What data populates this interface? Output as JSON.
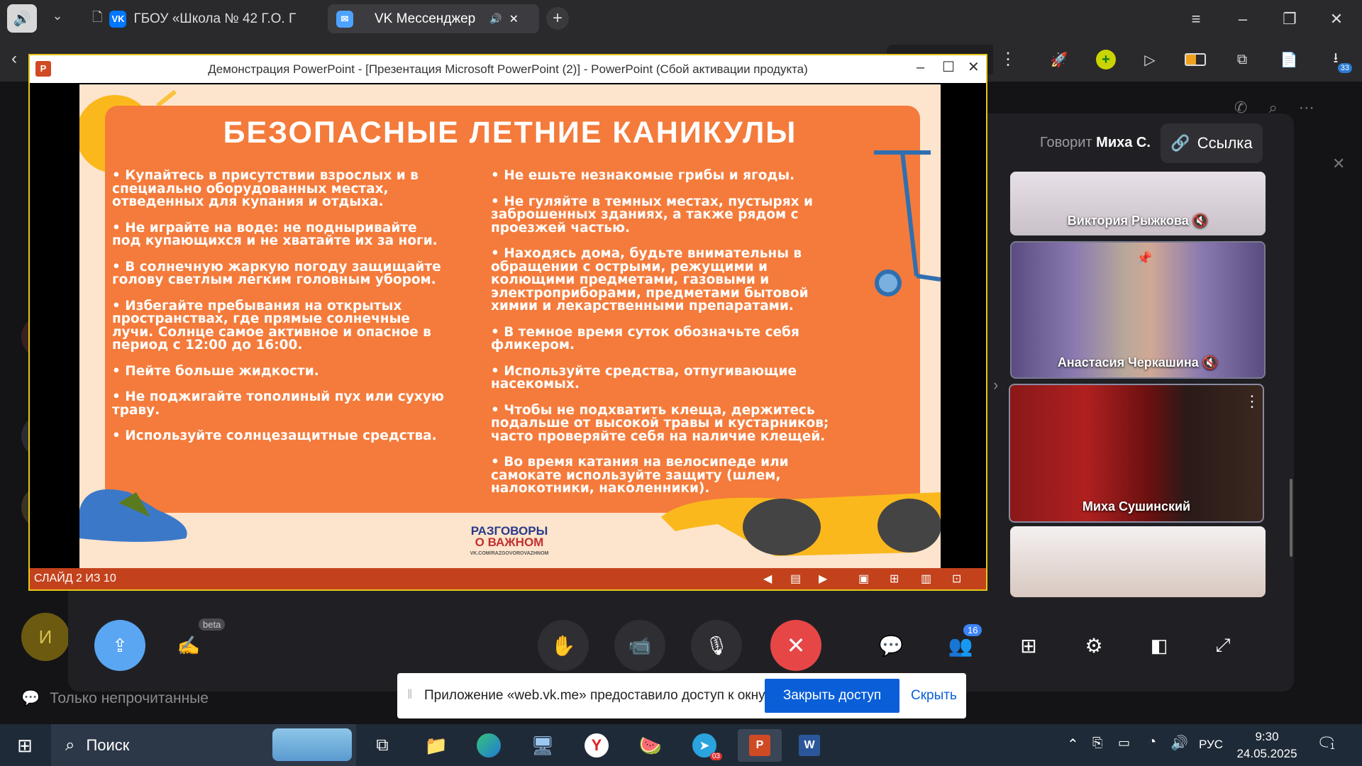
{
  "browser": {
    "tabs": [
      {
        "title": "ГБОУ «Школа № 42 Г.О. Г"
      },
      {
        "title": "VK Мессенджер"
      }
    ],
    "download_count": "33"
  },
  "ppt_window": {
    "title": "Демонстрация PowerPoint - [Презентация Microsoft PowerPoint (2)] - PowerPoint (Сбой активации продукта)",
    "slide": {
      "title": "БЕЗОПАСНЫЕ ЛЕТНИЕ КАНИКУЛЫ",
      "left_column": [
        "• Купайтесь в присутствии взрослых и в специально оборудованных местах, отведенных для купания и отдыха.",
        "• Не играйте на воде: не подныривайте под купающихся и не хватайте их за ноги.",
        "• В солнечную жаркую погоду защищайте голову светлым легким головным убором.",
        "• Избегайте пребывания на открытых пространствах, где прямые солнечные лучи. Солнце самое активное и опасное в период с 12:00 до 16:00.",
        "• Пейте больше жидкости.",
        "• Не поджигайте тополиный пух или сухую траву.",
        "• Используйте солнцезащитные средства."
      ],
      "right_column": [
        "• Не ешьте незнакомые грибы и ягоды.",
        "• Не гуляйте в темных местах, пустырях и заброшенных зданиях, а также рядом с проезжей частью.",
        "• Находясь дома, будьте внимательны в обращении с острыми, режущими и колющими предметами, газовыми и электроприборами, предметами бытовой химии и лекарственными препаратами.",
        "• В темное время суток обозначьте себя фликером.",
        "• Используйте средства, отпугивающие насекомых.",
        "• Чтобы не подхватить клеща, держитесь подальше от высокой травы и кустарников; часто проверяйте себя на наличие клещей.",
        "• Во время катания на велосипеде или самокате используйте защиту (шлем, налокотники, наколенники)."
      ],
      "logo_line1": "РАЗГОВОРЫ",
      "logo_line2": "О ВАЖНОМ",
      "logo_url": "VK.COM/RAZGOVOROVAZHNOM"
    },
    "status": "СЛАЙД 2 ИЗ 10"
  },
  "call": {
    "speaking_prefix": "Говорит",
    "speaking_name": "Миха С.",
    "link_label": "Ссылка",
    "participants": [
      {
        "name": "Виктория Рыжкова"
      },
      {
        "name": "Анастасия Черкашина"
      },
      {
        "name": "Миха Сушинский"
      }
    ],
    "controls": {
      "beta_label": "beta",
      "participants_count": "16"
    },
    "sidebar_avatar_letter": "И",
    "sidebar_filter": "Только непрочитанные"
  },
  "share_banner": {
    "message": "Приложение «web.vk.me» предоставило доступ к окну.",
    "stop_label": "Закрыть доступ",
    "hide_label": "Скрыть"
  },
  "taskbar": {
    "search_label": "Поиск",
    "lang": "РУС",
    "time": "9:30",
    "date": "24.05.2025",
    "telegram_badge": "03",
    "notification_count": "1"
  },
  "colors": {
    "vk_blue": "#0077ff",
    "end_call_red": "#e64646",
    "share_blue": "#0a5fd8",
    "slide_orange": "#f47b3b",
    "ppt_status": "#c3421c"
  }
}
